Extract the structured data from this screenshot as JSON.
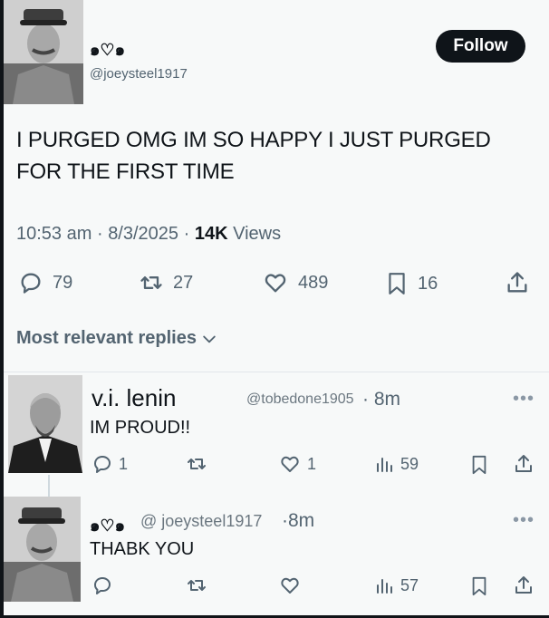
{
  "main_tweet": {
    "author_name": "๑♡๑",
    "author_handle": "@joeysteel1917",
    "follow_label": "Follow",
    "text": "I PURGED OMG IM SO HAPPY I JUST PURGED FOR THE FIRST TIME",
    "time": "10:53 am",
    "date": "8/3/2025",
    "views_count": "14K",
    "views_label": "Views",
    "replies": "79",
    "reposts": "27",
    "likes": "489",
    "bookmarks": "16"
  },
  "replies_header": "Most relevant replies",
  "reply_1": {
    "author_name": "v.i. lenin",
    "author_handle": "@tobedone1905",
    "time": "· 8m",
    "text": "IM PROUD!!",
    "replies": "1",
    "likes": "1",
    "views": "59",
    "more": "•••"
  },
  "reply_2": {
    "author_name": "๑♡๑",
    "author_handle": "@ joeysteel1917",
    "time": "·8m",
    "text": "THABK YOU",
    "views": "57",
    "more": "•••"
  },
  "icons": [
    "reply-icon",
    "repost-icon",
    "like-icon",
    "bookmark-icon",
    "share-icon",
    "views-icon",
    "chevron-down-icon",
    "more-icon"
  ],
  "colors": {
    "follow_bg": "#0f1419",
    "muted": "#536471",
    "background": "#f7f9f9"
  }
}
